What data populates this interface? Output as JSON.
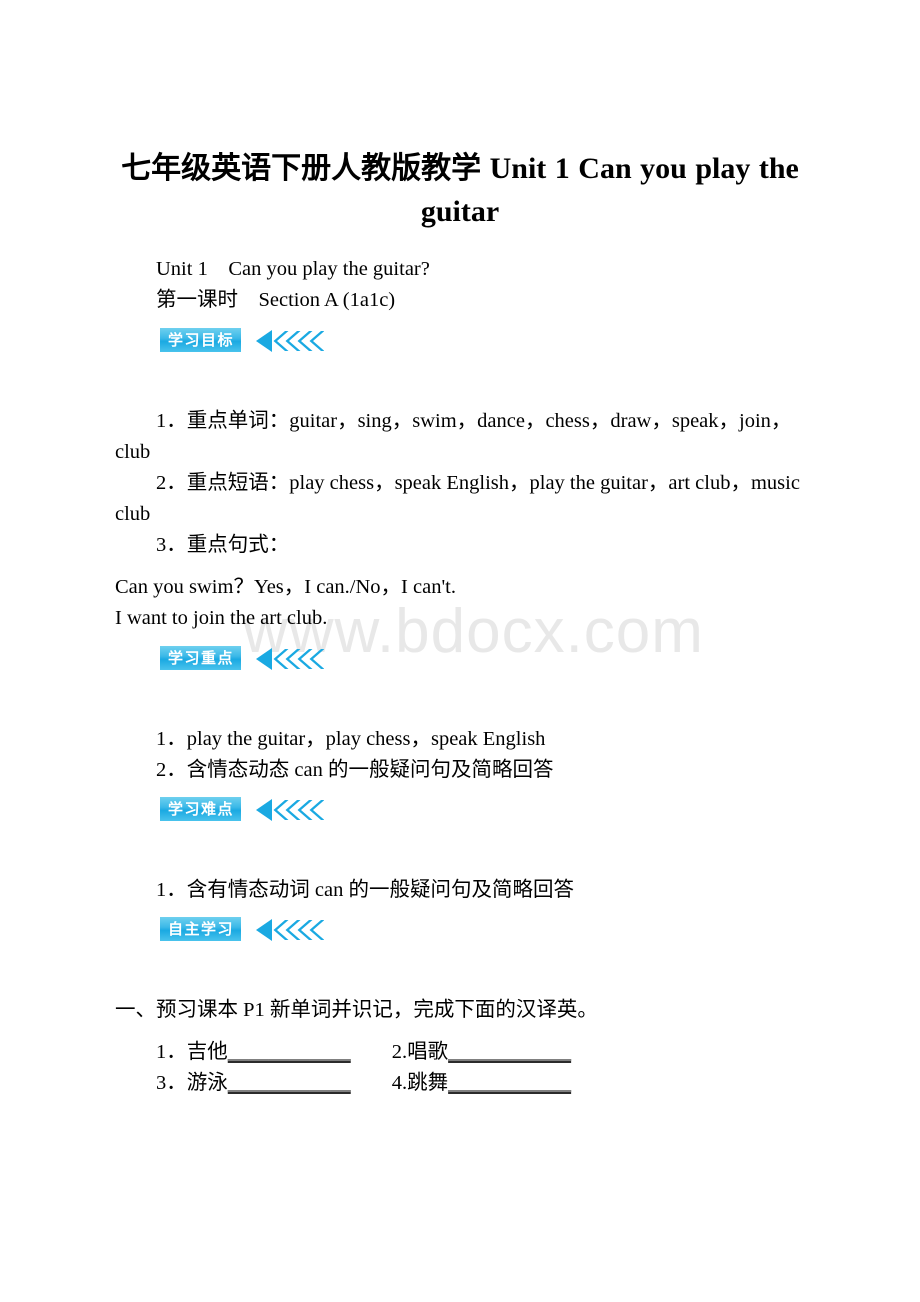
{
  "document": {
    "title_line_1": "七年级英语下册人教版教学 Unit 1 Can you",
    "title_line_2": "play the guitar",
    "watermark": "www.bdocx.com",
    "accent_color": "#1aa9e2",
    "accent_color_light": "#6fd0ef"
  },
  "header": {
    "unit_line": "Unit 1　Can you play the guitar?",
    "period_line": "第一课时　Section A (1a1c)"
  },
  "sections": [
    {
      "badge": "学习目标",
      "items": [
        "1．重点单词：guitar，sing，swim，dance，chess，draw，speak，join，club",
        "2．重点短语：play chess，speak English，play the guitar，art club，music club",
        "3．重点句式："
      ],
      "extra": [
        "Can you swim？Yes，I can./No，I can't.",
        "I want to join the art club."
      ]
    },
    {
      "badge": "学习重点",
      "items": [
        "1．play the guitar，play chess，speak English",
        "2．含情态动态 can 的一般疑问句及简略回答"
      ],
      "extra": []
    },
    {
      "badge": "学习难点",
      "items": [
        "1．含有情态动词 can 的一般疑问句及简略回答"
      ],
      "extra": []
    },
    {
      "badge": "自主学习",
      "items": [
        "一、预习课本 P1 新单词并识记，完成下面的汉译英。"
      ],
      "extra": []
    }
  ],
  "exercise": {
    "rows": [
      {
        "left_number": "1．",
        "left_word": "吉他",
        "left_blank": "____________",
        "spacer": "　　",
        "right_number": "2.",
        "right_word": "唱歌",
        "right_blank": "____________"
      },
      {
        "left_number": "3．",
        "left_word": "游泳",
        "left_blank": "____________",
        "spacer": "　　",
        "right_number": "4.",
        "right_word": "跳舞",
        "right_blank": "____________"
      }
    ]
  }
}
